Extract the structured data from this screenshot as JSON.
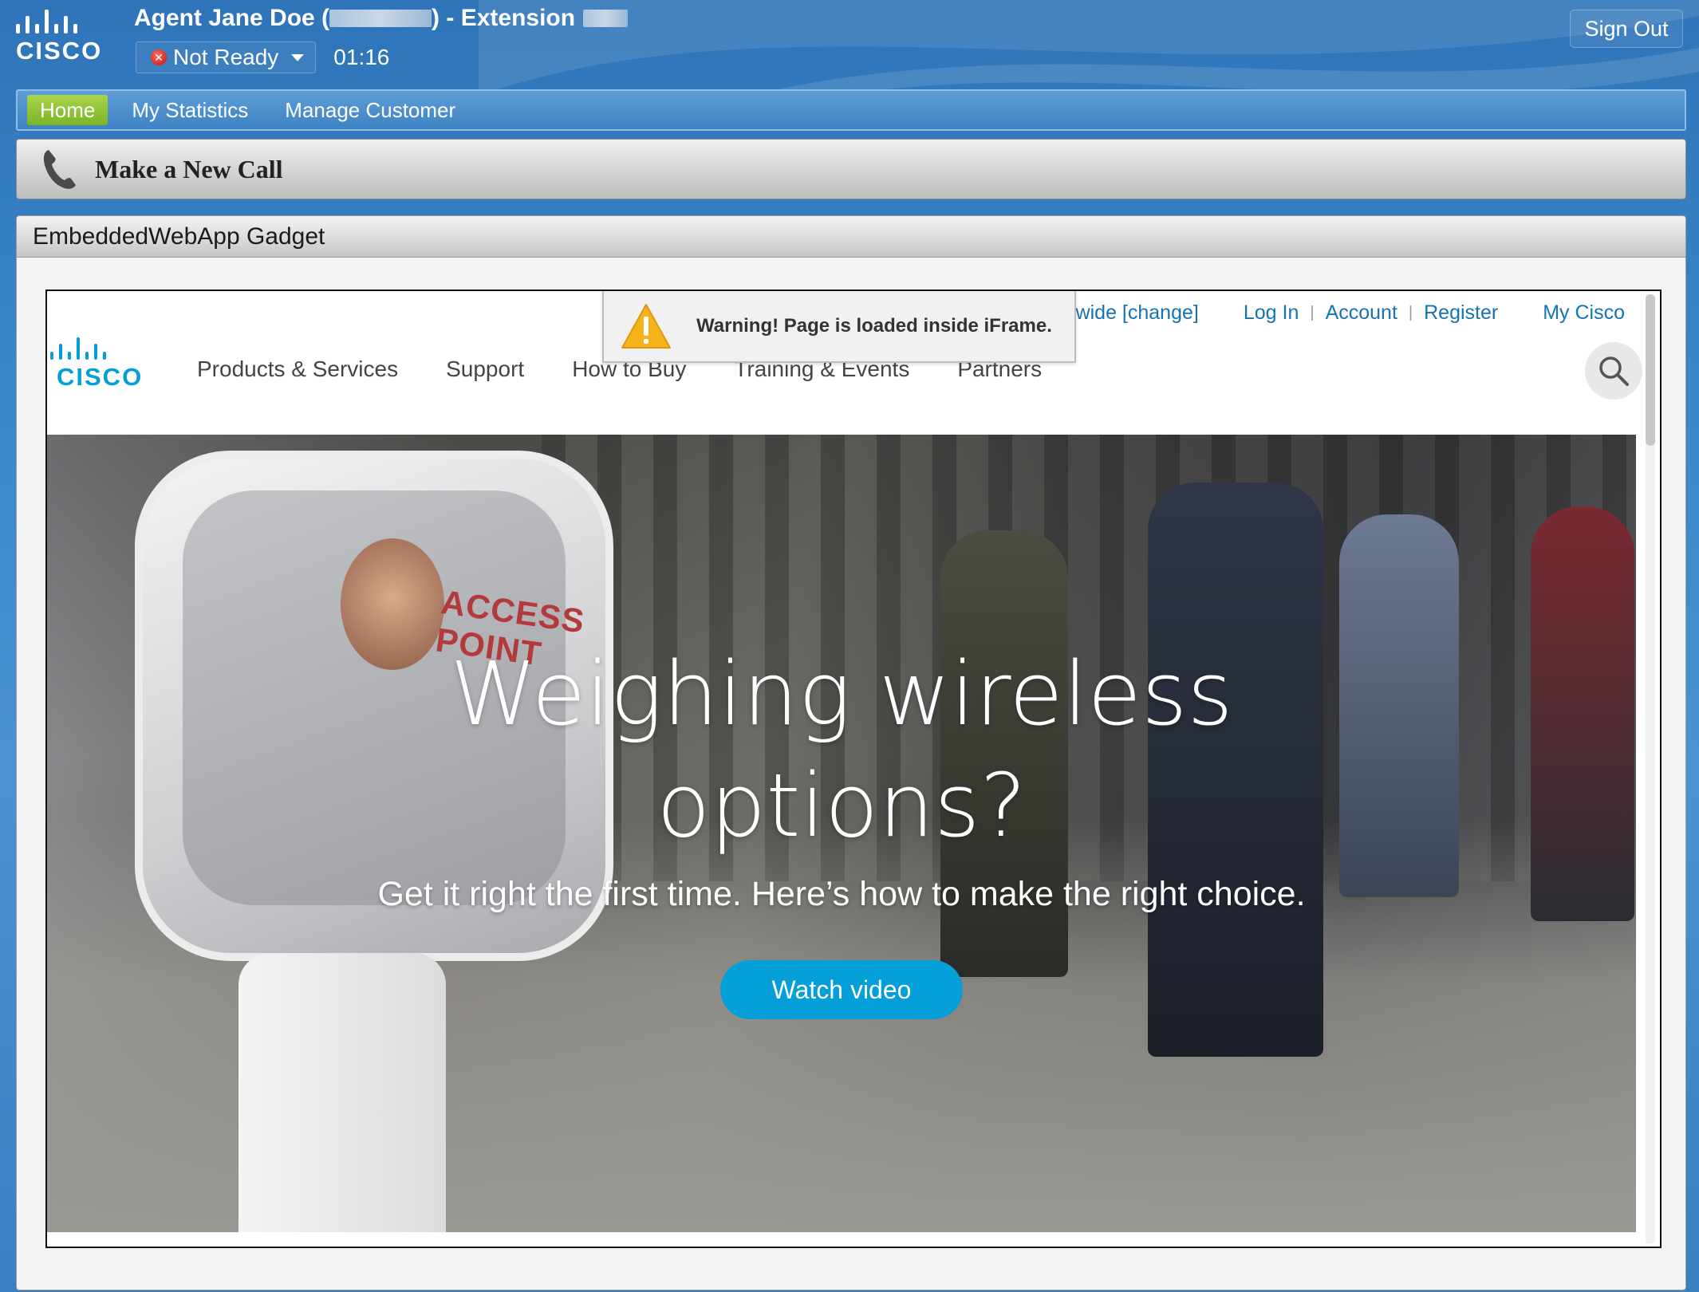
{
  "header": {
    "brand": "CISCO",
    "agent_prefix": "Agent Jane Doe (",
    "agent_mid": ") - Extension",
    "state_label": "Not Ready",
    "timer": "01:16",
    "sign_out_label": "Sign Out"
  },
  "nav": {
    "items": [
      {
        "label": "Home",
        "active": true
      },
      {
        "label": "My Statistics",
        "active": false
      },
      {
        "label": "Manage Customer",
        "active": false
      }
    ]
  },
  "call_bar": {
    "label": "Make a New Call"
  },
  "gadget": {
    "title": "EmbeddedWebApp Gadget"
  },
  "iframe": {
    "warning": "Warning! Page is loaded inside iFrame.",
    "top_links": [
      "ldwide [change]",
      "Log In",
      "Account",
      "Register",
      "My Cisco"
    ],
    "brand": "CISCO",
    "nav_items": [
      "Products & Services",
      "Support",
      "How to Buy",
      "Training & Events",
      "Partners"
    ],
    "hero": {
      "title_line1": "Weighing wireless",
      "title_line2": "options?",
      "costume_text": "ACCESS POINT",
      "subtitle": "Get it right the first time. Here’s how to make the right choice.",
      "cta_label": "Watch video"
    }
  },
  "colors": {
    "background_blue": "#3a86c8",
    "nav_active_green": "#8cc63f",
    "cisco_blue": "#049fd9",
    "link_blue": "#1473b5",
    "not_ready_red": "#d9261c"
  }
}
